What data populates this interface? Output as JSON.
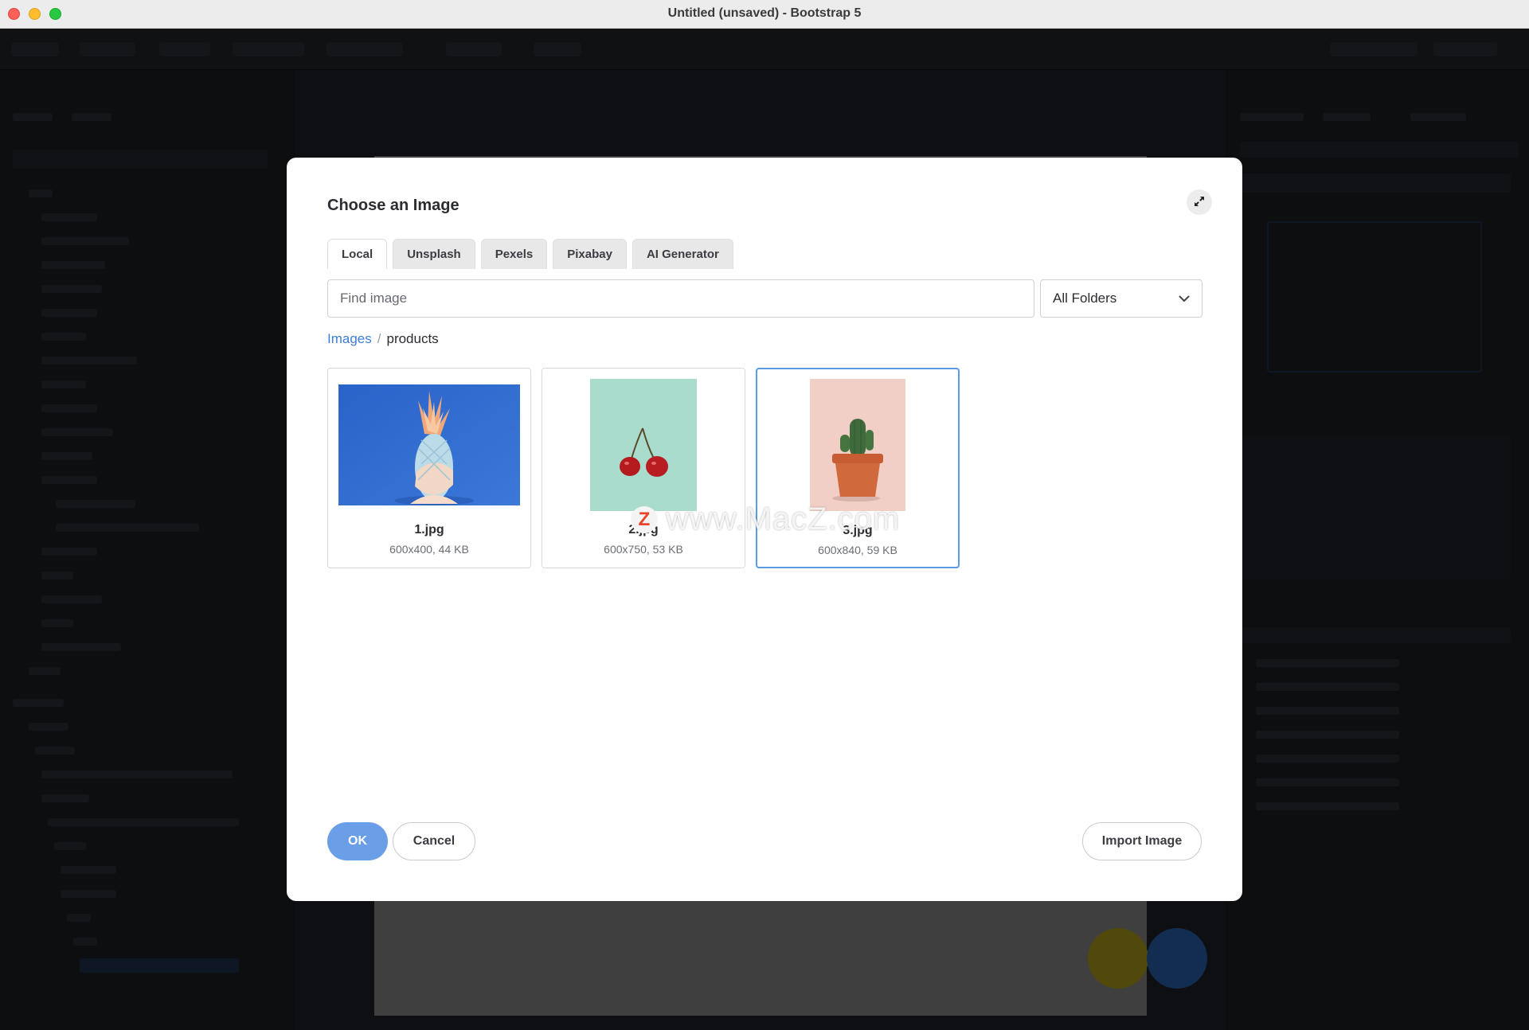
{
  "window": {
    "title": "Untitled (unsaved) - Bootstrap 5"
  },
  "dialog": {
    "title": "Choose an Image",
    "expand_icon": "expand-arrows-icon",
    "tabs": [
      {
        "label": "Local",
        "active": true
      },
      {
        "label": "Unsplash",
        "active": false
      },
      {
        "label": "Pexels",
        "active": false
      },
      {
        "label": "Pixabay",
        "active": false
      },
      {
        "label": "AI Generator",
        "active": false
      }
    ],
    "search": {
      "placeholder": "Find image",
      "value": ""
    },
    "folder_select": {
      "value": "All Folders",
      "icon": "chevron-down-icon"
    },
    "breadcrumb": {
      "root": "Images",
      "separator": "/",
      "current": "products"
    },
    "images": [
      {
        "name": "1.jpg",
        "meta": "600x400, 44 KB",
        "selected": false,
        "subject": "pineapple on blue background"
      },
      {
        "name": "2.jpg",
        "meta": "600x750, 53 KB",
        "selected": false,
        "subject": "cherries on mint background"
      },
      {
        "name": "3.jpg",
        "meta": "600x840, 59 KB",
        "selected": true,
        "subject": "potted cactus on pink background"
      }
    ],
    "watermark": {
      "logo_letter": "Z",
      "text": "www.MacZ.com"
    },
    "buttons": {
      "ok": "OK",
      "cancel": "Cancel",
      "import": "Import Image"
    }
  },
  "colors": {
    "accent": "#3d7ed8",
    "ok_button": "#6a9ee6",
    "selected_border": "#5b9bdf",
    "app_background": "#202228"
  }
}
